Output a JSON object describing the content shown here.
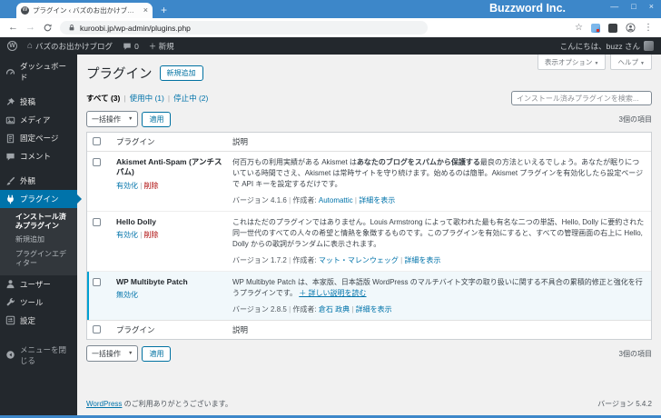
{
  "browser": {
    "tab_title": "プラグイン ‹ バズのお出かけブログ — W",
    "window_title": "Buzzword Inc.",
    "url": "kuroobi.jp/wp-admin/plugins.php",
    "glyphs": {
      "back": "←",
      "forward": "→",
      "new_tab": "+",
      "tab_close": "×",
      "minimize": "—",
      "maximize": "□",
      "close": "×",
      "star": "☆",
      "kebab": "⋮",
      "wp_favicon": "W"
    }
  },
  "adminbar": {
    "wp_logo": "W",
    "home_glyph": "⌂",
    "site_name": "バズのお出かけブログ",
    "comments_count": "0",
    "new_label": "＋ 新規",
    "greeting": "こんにちは、buzz さん"
  },
  "sidebar": {
    "items": [
      {
        "label": "ダッシュボード"
      },
      {
        "label": "投稿"
      },
      {
        "label": "メディア"
      },
      {
        "label": "固定ページ"
      },
      {
        "label": "コメント"
      },
      {
        "label": "外観"
      },
      {
        "label": "プラグイン"
      },
      {
        "label": "ユーザー"
      },
      {
        "label": "ツール"
      },
      {
        "label": "設定"
      }
    ],
    "submenu": [
      {
        "label": "インストール済みプラグイン"
      },
      {
        "label": "新規追加"
      },
      {
        "label": "プラグインエディター"
      }
    ],
    "collapse_label": "メニューを閉じる"
  },
  "page": {
    "title": "プラグイン",
    "add_new": "新規追加",
    "screen_options": "表示オプション",
    "help": "ヘルプ",
    "caret": "▼",
    "sep": "|",
    "filters": [
      {
        "label": "すべて",
        "count": "(3)"
      },
      {
        "label": "使用中",
        "count": "(1)"
      },
      {
        "label": "停止中",
        "count": "(2)"
      }
    ],
    "search_placeholder": "インストール済みプラグインを検索...",
    "bulk_action": "一括操作",
    "apply": "適用",
    "items_count": "3個の項目",
    "table": {
      "col_plugin": "プラグイン",
      "col_desc": "説明",
      "author_label": "作成者: ",
      "details_label": "詳細を表示",
      "rows": [
        {
          "name": "Akismet Anti-Spam (アンチスパム)",
          "action1": "有効化",
          "action2": "削除",
          "desc_pre": "何百万もの利用実績がある Akismet は",
          "desc_bold": "あなたのブログをスパムから保護する",
          "desc_post": "最良の方法といえるでしょう。あなたが眠りについている時間でさえ、Akismet は常時サイトを守り続けます。始めるのは簡単。Akismet プラグインを有効化したら設定ページで API キーを設定するだけです。",
          "version": "バージョン 4.1.6",
          "author": "Automattic"
        },
        {
          "name": "Hello Dolly",
          "action1": "有効化",
          "action2": "削除",
          "desc": "これはただのプラグインではありません。Louis Armstrong によって歌われた最も有名な二つの単語、Hello, Dolly に要約された同一世代のすべての人々の希望と情熱を象徴するものです。このプラグインを有効にすると、すべての管理画面の右上に Hello, Dolly からの歌詞がランダムに表示されます。",
          "version": "バージョン 1.7.2",
          "author": "マット・マレンウェッグ"
        },
        {
          "name": "WP Multibyte Patch",
          "action1": "無効化",
          "desc": "WP Multibyte Patch は、本家版、日本語版 WordPress のマルチバイト文字の取り扱いに関する不具合の累積的修正と強化を行うプラグインです。",
          "read_more": "＋ 詳しい説明を読む",
          "version": "バージョン 2.8.5",
          "author": "倉石 政典"
        }
      ]
    },
    "footer_link": "WordPress",
    "footer_rest": " のご利用ありがとうございます。",
    "footer_version": "バージョン 5.4.2"
  },
  "colors": {
    "accent": "#3d87c9",
    "menu_highlight": "#0073aa",
    "link": "#0073aa",
    "delete": "#a00",
    "active_row_border": "#00a0d2"
  }
}
